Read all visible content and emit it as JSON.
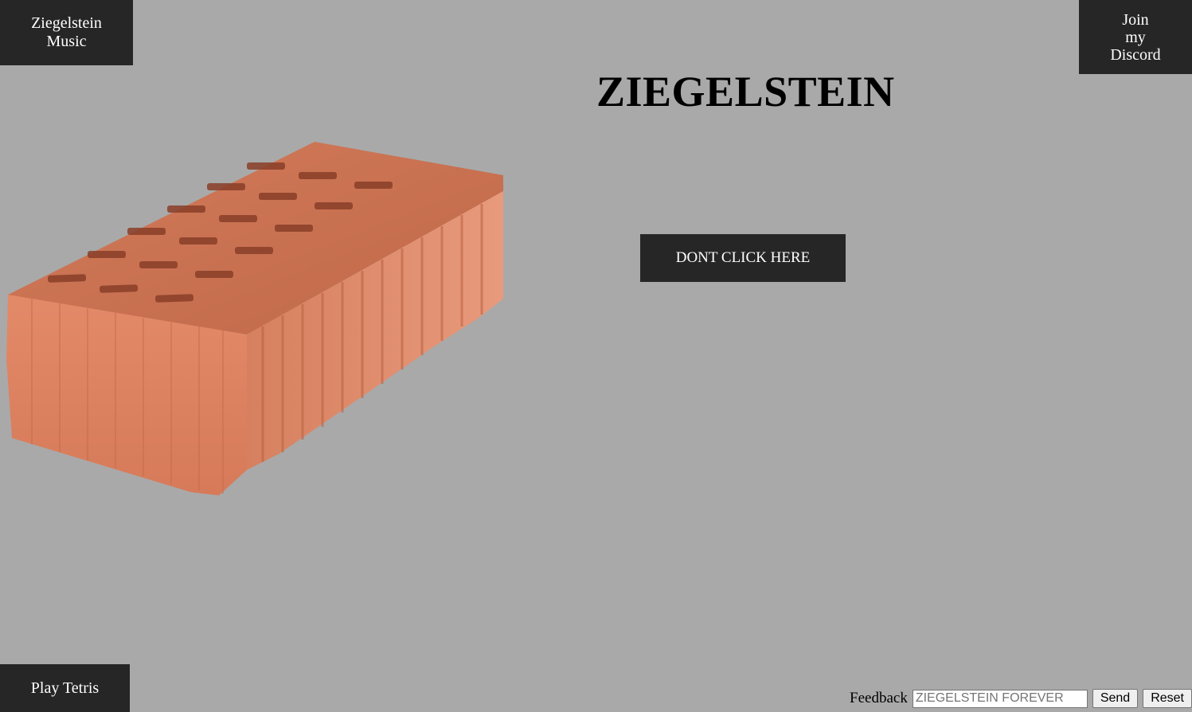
{
  "nav": {
    "music_label": "Ziegelstein Music",
    "discord_label": "Join my Discord",
    "tetris_label": "Play Tetris"
  },
  "main": {
    "title": "ZIEGELSTEIN",
    "cta_label": "DONT CLICK HERE"
  },
  "feedback": {
    "label": "Feedback",
    "placeholder": "ZIEGELSTEIN FOREVER",
    "value": "",
    "send_label": "Send",
    "reset_label": "Reset"
  },
  "colors": {
    "background": "#a9a9a9",
    "nav_bg": "#262626",
    "brick": "#d9805e"
  }
}
